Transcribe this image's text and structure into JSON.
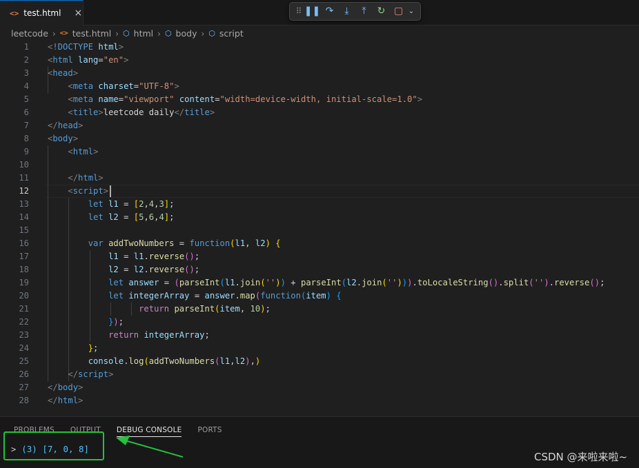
{
  "tab": {
    "icon": "html-file-icon",
    "label": "test.html",
    "close": "×"
  },
  "debug_toolbar": {
    "buttons": [
      "drag-grip",
      "pause",
      "step-over",
      "step-into",
      "step-out",
      "restart",
      "stop",
      "more-options"
    ]
  },
  "breadcrumb": {
    "items": [
      "leetcode",
      "test.html",
      "html",
      "body",
      "script"
    ]
  },
  "editor": {
    "current_line": 12,
    "line_numbers": [
      "1",
      "2",
      "3",
      "4",
      "5",
      "6",
      "7",
      "8",
      "9",
      "10",
      "11",
      "12",
      "13",
      "14",
      "15",
      "16",
      "17",
      "18",
      "19",
      "20",
      "21",
      "22",
      "23",
      "24",
      "25",
      "26",
      "27",
      "28"
    ],
    "lines": [
      [
        [
          "t-br",
          "<"
        ],
        [
          "t-tag",
          "!DOCTYPE"
        ],
        [
          "t-txt",
          " "
        ],
        [
          "t-attr",
          "html"
        ],
        [
          "t-br",
          ">"
        ]
      ],
      [
        [
          "t-br",
          "<"
        ],
        [
          "t-tag",
          "html"
        ],
        [
          "t-txt",
          " "
        ],
        [
          "t-attr",
          "lang"
        ],
        [
          "t-txt",
          "="
        ],
        [
          "t-str",
          "\"en\""
        ],
        [
          "t-br",
          ">"
        ]
      ],
      [
        [
          "t-br",
          "<"
        ],
        [
          "t-tag",
          "head"
        ],
        [
          "t-br",
          ">"
        ]
      ],
      [
        [
          "t-txt",
          "    "
        ],
        [
          "t-br",
          "<"
        ],
        [
          "t-tag",
          "meta"
        ],
        [
          "t-txt",
          " "
        ],
        [
          "t-attr",
          "charset"
        ],
        [
          "t-txt",
          "="
        ],
        [
          "t-str",
          "\"UTF-8\""
        ],
        [
          "t-br",
          ">"
        ]
      ],
      [
        [
          "t-txt",
          "    "
        ],
        [
          "t-br",
          "<"
        ],
        [
          "t-tag",
          "meta"
        ],
        [
          "t-txt",
          " "
        ],
        [
          "t-attr",
          "name"
        ],
        [
          "t-txt",
          "="
        ],
        [
          "t-str",
          "\"viewport\""
        ],
        [
          "t-txt",
          " "
        ],
        [
          "t-attr",
          "content"
        ],
        [
          "t-txt",
          "="
        ],
        [
          "t-str",
          "\"width=device-width, initial-scale=1.0\""
        ],
        [
          "t-br",
          ">"
        ]
      ],
      [
        [
          "t-txt",
          "    "
        ],
        [
          "t-br",
          "<"
        ],
        [
          "t-tag",
          "title"
        ],
        [
          "t-br",
          ">"
        ],
        [
          "t-txt",
          "leetcode daily"
        ],
        [
          "t-br",
          "</"
        ],
        [
          "t-tag",
          "title"
        ],
        [
          "t-br",
          ">"
        ]
      ],
      [
        [
          "t-br",
          "</"
        ],
        [
          "t-tag",
          "head"
        ],
        [
          "t-br",
          ">"
        ]
      ],
      [
        [
          "t-br",
          "<"
        ],
        [
          "t-tag",
          "body"
        ],
        [
          "t-br",
          ">"
        ]
      ],
      [
        [
          "t-txt",
          "    "
        ],
        [
          "t-br",
          "<"
        ],
        [
          "t-tag",
          "html"
        ],
        [
          "t-br",
          ">"
        ]
      ],
      [],
      [
        [
          "t-txt",
          "    "
        ],
        [
          "t-br",
          "</"
        ],
        [
          "t-tag",
          "html"
        ],
        [
          "t-br",
          ">"
        ]
      ],
      [
        [
          "t-txt",
          "    "
        ],
        [
          "t-br",
          "<"
        ],
        [
          "t-tag",
          "script"
        ],
        [
          "t-br",
          ">"
        ]
      ],
      [
        [
          "t-txt",
          "        "
        ],
        [
          "t-kw",
          "let"
        ],
        [
          "t-txt",
          " "
        ],
        [
          "t-var",
          "l1"
        ],
        [
          "t-txt",
          " = "
        ],
        [
          "t-p1",
          "["
        ],
        [
          "t-num",
          "2"
        ],
        [
          "t-txt",
          ","
        ],
        [
          "t-num",
          "4"
        ],
        [
          "t-txt",
          ","
        ],
        [
          "t-num",
          "3"
        ],
        [
          "t-p1",
          "]"
        ],
        [
          "t-txt",
          ";"
        ]
      ],
      [
        [
          "t-txt",
          "        "
        ],
        [
          "t-kw",
          "let"
        ],
        [
          "t-txt",
          " "
        ],
        [
          "t-var",
          "l2"
        ],
        [
          "t-txt",
          " = "
        ],
        [
          "t-p1",
          "["
        ],
        [
          "t-num",
          "5"
        ],
        [
          "t-txt",
          ","
        ],
        [
          "t-num",
          "6"
        ],
        [
          "t-txt",
          ","
        ],
        [
          "t-num",
          "4"
        ],
        [
          "t-p1",
          "]"
        ],
        [
          "t-txt",
          ";"
        ]
      ],
      [],
      [
        [
          "t-txt",
          "        "
        ],
        [
          "t-kw",
          "var"
        ],
        [
          "t-txt",
          " "
        ],
        [
          "t-fn",
          "addTwoNumbers"
        ],
        [
          "t-txt",
          " = "
        ],
        [
          "t-kw",
          "function"
        ],
        [
          "t-p1",
          "("
        ],
        [
          "t-var",
          "l1"
        ],
        [
          "t-txt",
          ", "
        ],
        [
          "t-var",
          "l2"
        ],
        [
          "t-p1",
          ")"
        ],
        [
          "t-txt",
          " "
        ],
        [
          "t-p1",
          "{"
        ]
      ],
      [
        [
          "t-txt",
          "            "
        ],
        [
          "t-var",
          "l1"
        ],
        [
          "t-txt",
          " = "
        ],
        [
          "t-var",
          "l1"
        ],
        [
          "t-txt",
          "."
        ],
        [
          "t-fn",
          "reverse"
        ],
        [
          "t-p2",
          "()"
        ],
        [
          "t-txt",
          ";"
        ]
      ],
      [
        [
          "t-txt",
          "            "
        ],
        [
          "t-var",
          "l2"
        ],
        [
          "t-txt",
          " = "
        ],
        [
          "t-var",
          "l2"
        ],
        [
          "t-txt",
          "."
        ],
        [
          "t-fn",
          "reverse"
        ],
        [
          "t-p2",
          "()"
        ],
        [
          "t-txt",
          ";"
        ]
      ],
      [
        [
          "t-txt",
          "            "
        ],
        [
          "t-kw",
          "let"
        ],
        [
          "t-txt",
          " "
        ],
        [
          "t-var",
          "answer"
        ],
        [
          "t-txt",
          " = "
        ],
        [
          "t-p2",
          "("
        ],
        [
          "t-fn",
          "parseInt"
        ],
        [
          "t-p3",
          "("
        ],
        [
          "t-var",
          "l1"
        ],
        [
          "t-txt",
          "."
        ],
        [
          "t-fn",
          "join"
        ],
        [
          "t-p1",
          "("
        ],
        [
          "t-str",
          "''"
        ],
        [
          "t-p1",
          ")"
        ],
        [
          "t-p3",
          ")"
        ],
        [
          "t-txt",
          " + "
        ],
        [
          "t-fn",
          "parseInt"
        ],
        [
          "t-p3",
          "("
        ],
        [
          "t-var",
          "l2"
        ],
        [
          "t-txt",
          "."
        ],
        [
          "t-fn",
          "join"
        ],
        [
          "t-p1",
          "("
        ],
        [
          "t-str",
          "''"
        ],
        [
          "t-p1",
          ")"
        ],
        [
          "t-p3",
          ")"
        ],
        [
          "t-p2",
          ")"
        ],
        [
          "t-txt",
          "."
        ],
        [
          "t-fn",
          "toLocaleString"
        ],
        [
          "t-p2",
          "()"
        ],
        [
          "t-txt",
          "."
        ],
        [
          "t-fn",
          "split"
        ],
        [
          "t-p2",
          "("
        ],
        [
          "t-str",
          "''"
        ],
        [
          "t-p2",
          ")"
        ],
        [
          "t-txt",
          "."
        ],
        [
          "t-fn",
          "reverse"
        ],
        [
          "t-p2",
          "()"
        ],
        [
          "t-txt",
          ";"
        ]
      ],
      [
        [
          "t-txt",
          "            "
        ],
        [
          "t-kw",
          "let"
        ],
        [
          "t-txt",
          " "
        ],
        [
          "t-var",
          "integerArray"
        ],
        [
          "t-txt",
          " = "
        ],
        [
          "t-var",
          "answer"
        ],
        [
          "t-txt",
          "."
        ],
        [
          "t-fn",
          "map"
        ],
        [
          "t-p2",
          "("
        ],
        [
          "t-kw",
          "function"
        ],
        [
          "t-p3",
          "("
        ],
        [
          "t-var",
          "item"
        ],
        [
          "t-p3",
          ")"
        ],
        [
          "t-txt",
          " "
        ],
        [
          "t-p3",
          "{"
        ]
      ],
      [
        [
          "t-txt",
          "                  "
        ],
        [
          "t-ctl",
          "return"
        ],
        [
          "t-txt",
          " "
        ],
        [
          "t-fn",
          "parseInt"
        ],
        [
          "t-p1",
          "("
        ],
        [
          "t-var",
          "item"
        ],
        [
          "t-txt",
          ", "
        ],
        [
          "t-num",
          "10"
        ],
        [
          "t-p1",
          ")"
        ],
        [
          "t-txt",
          ";"
        ]
      ],
      [
        [
          "t-txt",
          "            "
        ],
        [
          "t-p3",
          "}"
        ],
        [
          "t-p2",
          ")"
        ],
        [
          "t-txt",
          ";"
        ]
      ],
      [
        [
          "t-txt",
          "            "
        ],
        [
          "t-ctl",
          "return"
        ],
        [
          "t-txt",
          " "
        ],
        [
          "t-var",
          "integerArray"
        ],
        [
          "t-txt",
          ";"
        ]
      ],
      [
        [
          "t-txt",
          "        "
        ],
        [
          "t-p1",
          "}"
        ],
        [
          "t-txt",
          ";"
        ]
      ],
      [
        [
          "t-txt",
          "        "
        ],
        [
          "t-var",
          "console"
        ],
        [
          "t-txt",
          "."
        ],
        [
          "t-fn",
          "log"
        ],
        [
          "t-p1",
          "("
        ],
        [
          "t-fn",
          "addTwoNumbers"
        ],
        [
          "t-p2",
          "("
        ],
        [
          "t-var",
          "l1"
        ],
        [
          "t-txt",
          ","
        ],
        [
          "t-var",
          "l2"
        ],
        [
          "t-p2",
          ")"
        ],
        [
          "t-txt",
          ","
        ],
        [
          "t-p1",
          ")"
        ]
      ],
      [
        [
          "t-txt",
          "    "
        ],
        [
          "t-br",
          "</"
        ],
        [
          "t-tag",
          "script"
        ],
        [
          "t-br",
          ">"
        ]
      ],
      [
        [
          "t-br",
          "</"
        ],
        [
          "t-tag",
          "body"
        ],
        [
          "t-br",
          ">"
        ]
      ],
      [
        [
          "t-br",
          "</"
        ],
        [
          "t-tag",
          "html"
        ],
        [
          "t-br",
          ">"
        ]
      ]
    ]
  },
  "panel": {
    "tabs": [
      "PROBLEMS",
      "OUTPUT",
      "DEBUG CONSOLE",
      "PORTS"
    ],
    "active_tab": "DEBUG CONSOLE",
    "console_prompt": ">",
    "console_output": "(3) [7, 0, 8]"
  },
  "annotation": {
    "highlight_color": "#23c33a"
  },
  "watermark": "CSDN @来啦来啦~"
}
